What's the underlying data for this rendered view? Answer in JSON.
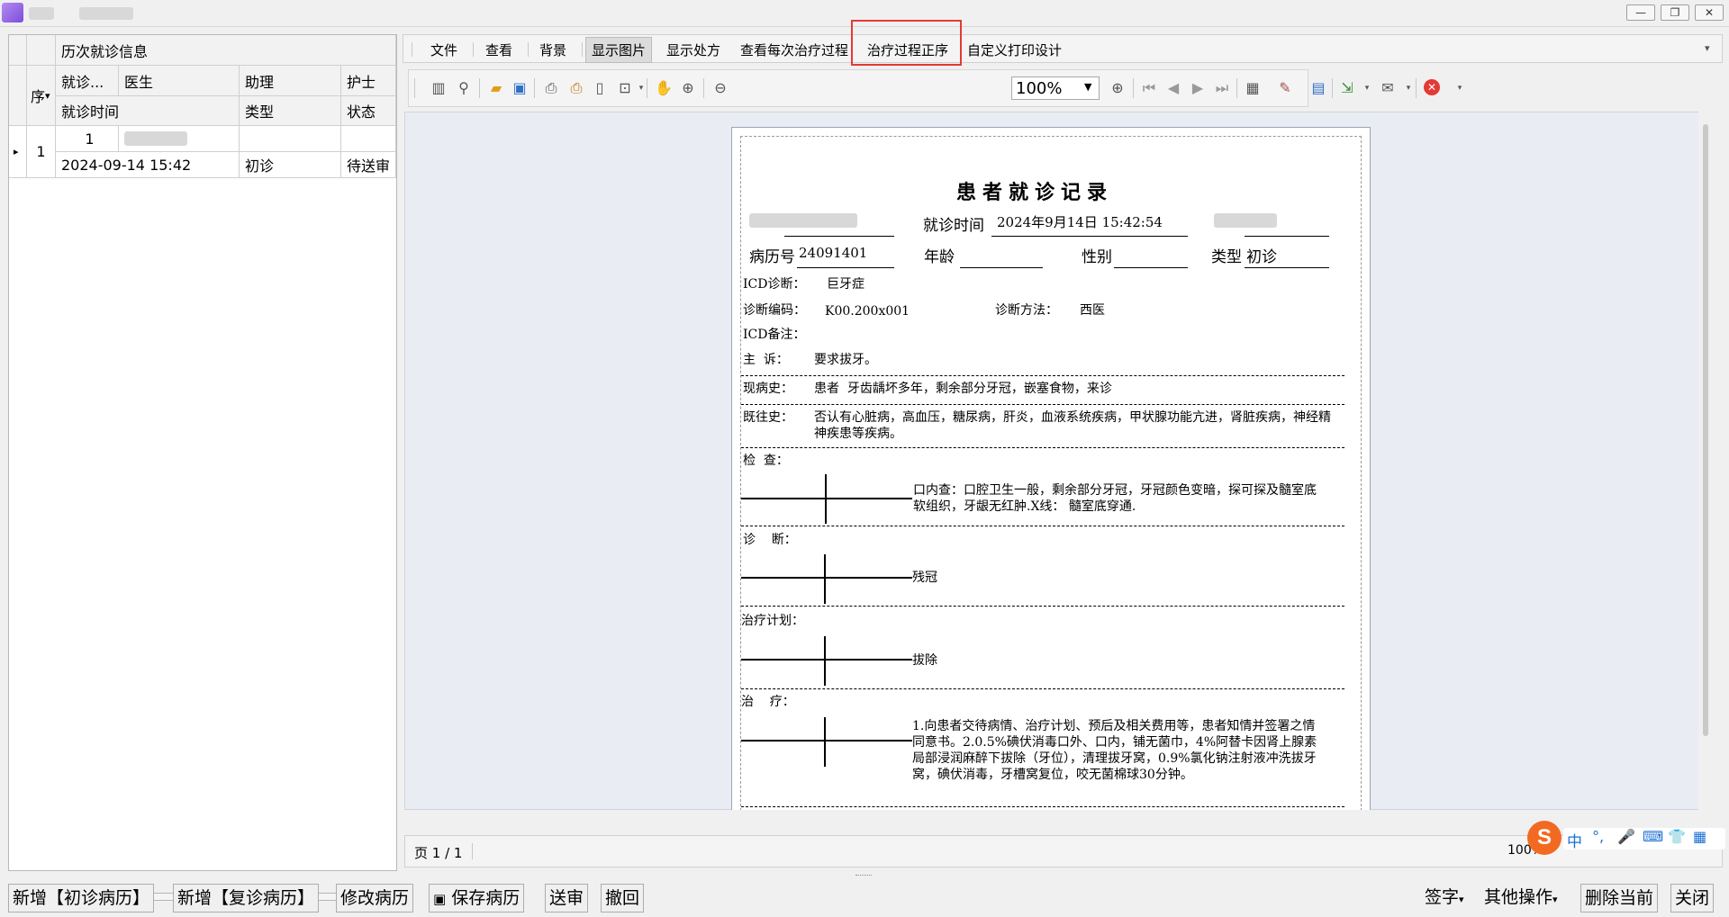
{
  "window": {
    "minimize": "—",
    "restore": "❐",
    "close": "✕"
  },
  "left_panel": {
    "group_header": "历次就诊信息",
    "seq_header": "序",
    "sort_glyph": "▾",
    "columns_row1": [
      "就诊...",
      "医生",
      "助理",
      "护士"
    ],
    "columns_row2": [
      "就诊时间",
      "类型",
      "状态"
    ],
    "rows": [
      {
        "indicator": "▸",
        "seq": "1",
        "visit_no": "1",
        "visit_time": "2024-09-14 15:42",
        "type": "初诊",
        "status": "待送审"
      }
    ]
  },
  "menu": {
    "items": [
      "文件",
      "查看",
      "背景",
      "显示图片",
      "显示处方",
      "查看每次治疗过程",
      "治疗过程正序",
      "自定义打印设计"
    ],
    "active": "显示图片",
    "highlighted": "治疗过程正序",
    "overflow": "▾"
  },
  "toolbar": {
    "zoom_value": "100%",
    "icons": [
      "layout-icon",
      "find-icon",
      "open-icon",
      "save-icon",
      "print-icon",
      "quick-print-icon",
      "page-setup-icon",
      "scale-icon",
      "hand-icon",
      "magnifier-icon",
      "zoom-out-icon",
      "zoom-in-icon",
      "first-page-icon",
      "prev-page-icon",
      "next-page-icon",
      "last-page-icon",
      "multi-page-icon",
      "color-icon",
      "watermark-icon",
      "export-icon",
      "email-icon",
      "close-preview-icon"
    ]
  },
  "document": {
    "title": "患者就诊记录",
    "visit_time_label": "就诊时间",
    "visit_time_value": "2024年9月14日 15:42:54",
    "record_no_label": "病历号",
    "record_no_value": "24091401",
    "age_label": "年龄",
    "gender_label": "性别",
    "type_label": "类型",
    "type_value": "初诊",
    "icd_diag_label": "ICD诊断：",
    "icd_diag_value": "巨牙症",
    "diag_code_label": "诊断编码：",
    "diag_code_value": "K00.200x001",
    "diag_method_label": "诊断方法：",
    "diag_method_value": "西医",
    "icd_note_label": "ICD备注：",
    "complaint_label": "主  诉：",
    "complaint_value": "要求拔牙。",
    "present_label": "现病史：",
    "present_value": "患者  牙齿龋坏多年，剩余部分牙冠，嵌塞食物，来诊",
    "past_label": "既往史：",
    "past_value": "否认有心脏病，高血压，糖尿病，肝炎，血液系统疾病，甲状腺功能亢进，肾脏疾病，神经精神疾患等疾病。",
    "exam_label": "检  查：",
    "exam_value": "口内查：口腔卫生一般，剩余部分牙冠，牙冠颜色变暗，探可探及髓室底软组织，牙龈无红肿.X线：  髓室底穿通.",
    "diagnosis_label": "诊    断：",
    "diagnosis_value": "残冠",
    "plan_label": "治疗计划：",
    "plan_value": "拔除",
    "treat_label": "治    疗：",
    "treat_value": "1.向患者交待病情、治疗计划、预后及相关费用等，患者知情并签署之情同意书。2.0.5%碘伏消毒口外、口内，铺无菌巾，4%阿替卡因肾上腺素局部浸润麻醉下拔除（牙位），清理拔牙窝，0.9%氯化钠注射液冲洗拔牙窝，碘伏消毒，牙槽窝复位，咬无菌棉球30分钟。"
  },
  "status": {
    "page": "页 1 / 1",
    "zoom": "100%"
  },
  "bottom_buttons": [
    "新增【初诊病历】",
    "新增【复诊病历】",
    "修改病历",
    "保存病历",
    "送审",
    "撤回"
  ],
  "bottom_right": [
    "签字",
    "其他操作",
    "删除当前",
    "关闭"
  ],
  "ime": {
    "logo": "S",
    "mode": "中"
  }
}
